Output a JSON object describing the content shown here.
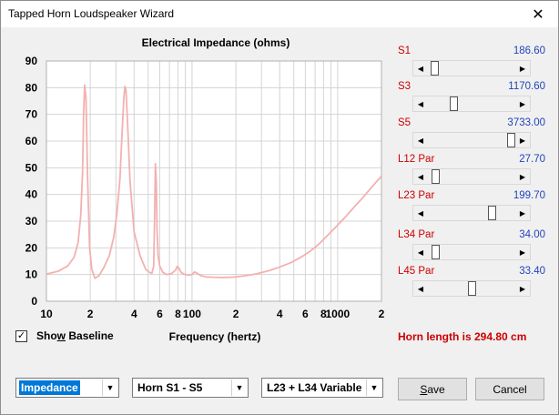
{
  "window": {
    "title": "Tapped Horn Loudspeaker Wizard",
    "close_glyph": "✕"
  },
  "chart_data": {
    "type": "line",
    "title": "Electrical Impedance (ohms)",
    "xlabel": "Frequency (hertz)",
    "ylabel": "",
    "x_scale": "log",
    "xlim": [
      10,
      2000
    ],
    "ylim": [
      0,
      90
    ],
    "yticks": [
      "0",
      "10",
      "20",
      "30",
      "40",
      "50",
      "60",
      "70",
      "80",
      "90"
    ],
    "xticks": [
      {
        "v": 10,
        "label": "10"
      },
      {
        "v": 20,
        "label": "2"
      },
      {
        "v": 40,
        "label": "4"
      },
      {
        "v": 60,
        "label": "6"
      },
      {
        "v": 80,
        "label": "8"
      },
      {
        "v": 100,
        "label": "100"
      },
      {
        "v": 200,
        "label": "2"
      },
      {
        "v": 400,
        "label": "4"
      },
      {
        "v": 600,
        "label": "6"
      },
      {
        "v": 800,
        "label": "8"
      },
      {
        "v": 1000,
        "label": "1000"
      },
      {
        "v": 2000,
        "label": "2"
      }
    ],
    "grid": true,
    "line_color": "#f4b0b0",
    "series": [
      {
        "x": [
          10,
          12,
          14,
          15.5,
          16.5,
          17.2,
          17.7,
          18.0,
          18.3,
          18.7,
          19.2,
          19.8,
          20.5,
          21.5,
          23,
          25,
          27,
          29,
          30.5,
          32,
          33,
          34,
          34.6,
          35.2,
          36,
          37.5,
          40,
          44,
          48,
          51,
          53,
          54.5,
          55.3,
          56,
          56.8,
          57.5,
          58.5,
          60,
          63,
          67,
          72,
          77,
          79,
          81,
          84,
          88,
          92,
          96,
          100,
          104,
          108,
          115,
          125,
          140,
          160,
          190,
          230,
          280,
          340,
          400,
          480,
          560,
          650,
          750,
          850,
          1000,
          1150,
          1300,
          1500,
          1700,
          1850,
          2000
        ],
        "y": [
          10.2,
          11.2,
          13.2,
          16.5,
          22,
          32,
          48,
          70,
          81,
          76,
          45,
          20,
          12,
          8.6,
          9.6,
          13,
          17,
          24,
          33,
          46,
          62,
          76,
          80.5,
          79,
          68,
          45,
          26,
          17,
          12,
          10.8,
          10.5,
          13,
          30,
          51.5,
          45,
          27,
          17,
          13.2,
          10.8,
          10,
          10.3,
          11.6,
          13,
          12.5,
          10.8,
          10.2,
          9.9,
          9.8,
          10,
          11,
          10.5,
          9.6,
          9.1,
          9.0,
          8.9,
          9.0,
          9.5,
          10.3,
          11.5,
          12.8,
          14.5,
          16.5,
          18.8,
          21.6,
          24.6,
          28.5,
          32,
          35.3,
          39,
          42.5,
          44.8,
          46.8
        ]
      }
    ]
  },
  "sliders": [
    {
      "label": "S1",
      "value": "186.60",
      "pos": 0.03
    },
    {
      "label": "S3",
      "value": "1170.60",
      "pos": 0.28
    },
    {
      "label": "S5",
      "value": "3733.00",
      "pos": 0.995
    },
    {
      "label": "L12  Par",
      "value": "27.70",
      "pos": 0.05
    },
    {
      "label": "L23  Par",
      "value": "199.70",
      "pos": 0.76
    },
    {
      "label": "L34  Par",
      "value": "34.00",
      "pos": 0.05
    },
    {
      "label": "L45  Par",
      "value": "33.40",
      "pos": 0.51
    }
  ],
  "baseline": {
    "checked_glyph": "✓",
    "label_pre": "Sho",
    "label_accel": "w",
    "label_post": " Baseline"
  },
  "horn_length": "Horn length is 294.80 cm",
  "dropdowns": {
    "mode": "Impedance",
    "horn": "Horn S1 - S5",
    "variable": "L23 + L34 Variable",
    "arrow_glyph": "▼"
  },
  "buttons": {
    "save_accel": "S",
    "save_rest": "ave",
    "cancel": "Cancel"
  },
  "scroll_arrows": {
    "left": "◀",
    "right": "▶"
  }
}
